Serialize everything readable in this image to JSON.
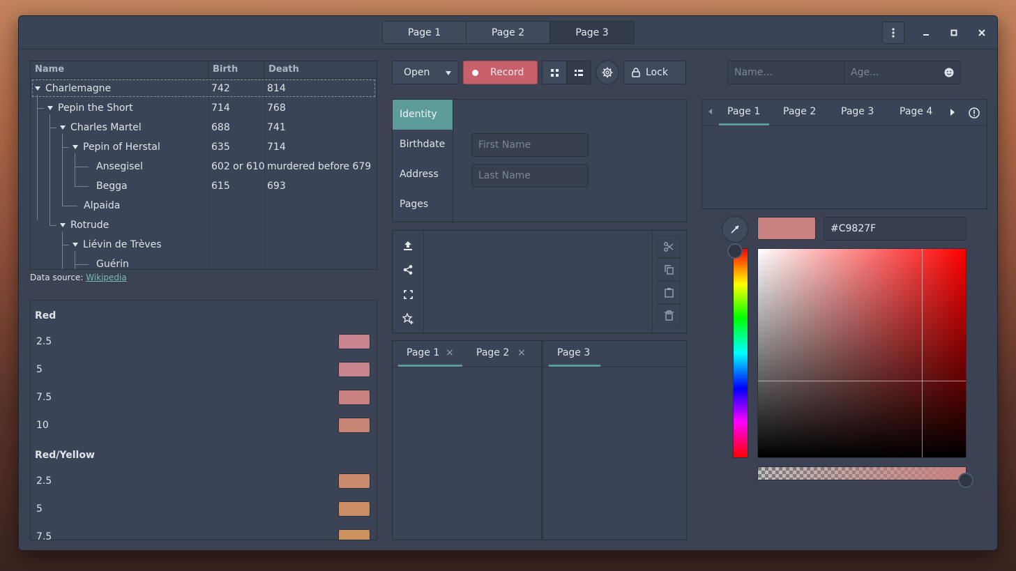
{
  "titlebar": {
    "tabs": [
      "Page 1",
      "Page 2",
      "Page 3"
    ],
    "active_tab": 2,
    "menu_icon": "kebab-menu-icon",
    "minimize_icon": "minimize-icon",
    "maximize_icon": "maximize-icon",
    "close_icon": "close-icon"
  },
  "tree": {
    "columns": [
      "Name",
      "Birth",
      "Death"
    ],
    "rows": [
      {
        "name": "Charlemagne",
        "birth": "742",
        "death": "814",
        "depth": 0,
        "expanded": true
      },
      {
        "name": "Pepin the Short",
        "birth": "714",
        "death": "768",
        "depth": 1,
        "expanded": true
      },
      {
        "name": "Charles Martel",
        "birth": "688",
        "death": "741",
        "depth": 2,
        "expanded": true
      },
      {
        "name": "Pepin of Herstal",
        "birth": "635",
        "death": "714",
        "depth": 3,
        "expanded": true
      },
      {
        "name": "Ansegisel",
        "birth": "602 or 610",
        "death": "murdered before 679",
        "depth": 4,
        "expanded": false
      },
      {
        "name": "Begga",
        "birth": "615",
        "death": "693",
        "depth": 4,
        "expanded": false
      },
      {
        "name": "Alpaida",
        "birth": "",
        "death": "",
        "depth": 3,
        "expanded": false
      },
      {
        "name": "Rotrude",
        "birth": "",
        "death": "",
        "depth": 2,
        "expanded": true
      },
      {
        "name": "Liévin de Trèves",
        "birth": "",
        "death": "",
        "depth": 3,
        "expanded": true
      },
      {
        "name": "Guérin",
        "birth": "",
        "death": "",
        "depth": 4,
        "expanded": false
      }
    ],
    "source_prefix": "Data source: ",
    "source_link": "Wikipedia"
  },
  "colors": {
    "groups": [
      {
        "title": "Red",
        "items": [
          {
            "label": "2.5",
            "color": "#c8848e"
          },
          {
            "label": "5",
            "color": "#c8848c"
          },
          {
            "label": "7.5",
            "color": "#c9827f"
          },
          {
            "label": "10",
            "color": "#c78675"
          }
        ]
      },
      {
        "title": "Red/Yellow",
        "items": [
          {
            "label": "2.5",
            "color": "#c98a6d"
          },
          {
            "label": "5",
            "color": "#cc8e65"
          },
          {
            "label": "7.5",
            "color": "#cc9260"
          }
        ]
      }
    ]
  },
  "toolbar": {
    "open_label": "Open",
    "record_label": "Record",
    "lock_label": "Lock",
    "grid_view_icon": "grid-view-icon",
    "list_view_icon": "list-view-icon",
    "settings_icon": "gear-icon"
  },
  "identity": {
    "tabs": [
      "Identity",
      "Birthdate",
      "Address",
      "Pages"
    ],
    "active_tab": 0,
    "first_name_placeholder": "First Name",
    "last_name_placeholder": "Last Name"
  },
  "actions": {
    "left_icons": [
      "upload-icon",
      "share-icon",
      "fullscreen-icon",
      "star-add-icon"
    ],
    "right_icons": [
      "cut-icon",
      "copy-icon",
      "paste-icon",
      "delete-icon"
    ]
  },
  "closable_tabs": {
    "left": [
      {
        "label": "Page 1"
      },
      {
        "label": "Page 2"
      }
    ],
    "right": [
      {
        "label": "Page 3"
      }
    ]
  },
  "person_search": {
    "name_placeholder": "Name...",
    "age_placeholder": "Age..."
  },
  "scroll_tabs": {
    "tabs": [
      "Page 1",
      "Page 2",
      "Page 3",
      "Page 4"
    ],
    "active_tab": 0
  },
  "color_picker": {
    "hex": "#C9827F",
    "current_color": "#c9827f",
    "hue_color": "#ff0000",
    "alpha": 1.0
  }
}
